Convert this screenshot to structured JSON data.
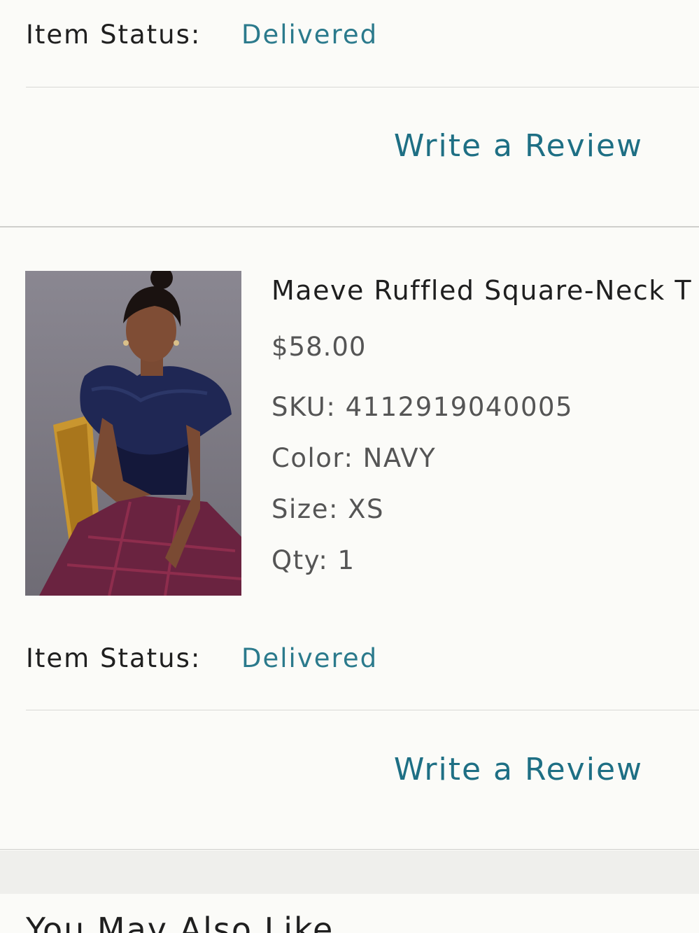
{
  "items": [
    {
      "status_label": "Item Status:",
      "status_value": "Delivered",
      "review_link": "Write a Review"
    },
    {
      "product_name": "Maeve Ruffled Square-Neck T",
      "price": "$58.00",
      "sku_line": "SKU: 4112919040005",
      "color_line": "Color: NAVY",
      "size_line": "Size: XS",
      "qty_line": "Qty: 1",
      "status_label": "Item Status:",
      "status_value": "Delivered",
      "review_link": "Write a Review"
    }
  ],
  "next_section": {
    "heading": "You May Also Like"
  },
  "colors": {
    "link": "#1e6f84",
    "status": "#2b7a8c",
    "background": "#fbfbf8"
  }
}
